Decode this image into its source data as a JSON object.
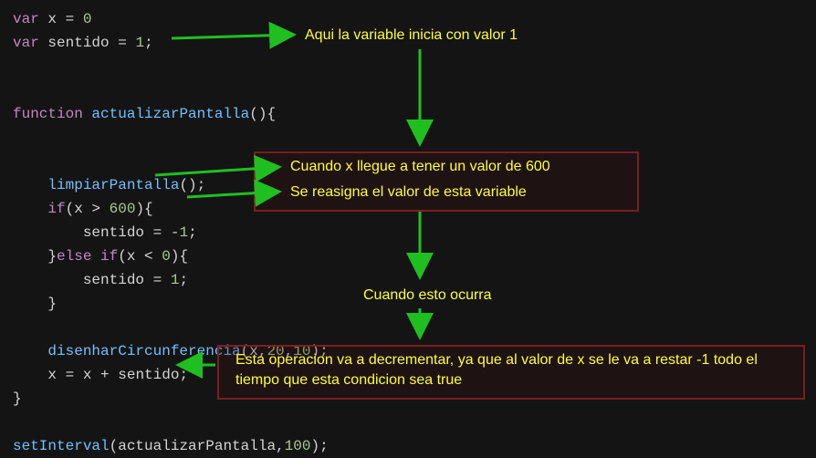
{
  "code": {
    "l1a": "var",
    "l1b": " x ",
    "l1c": "=",
    "l1d": " ",
    "l1e": "0",
    "l2a": "var",
    "l2b": " sentido ",
    "l2c": "=",
    "l2d": " ",
    "l2e": "1",
    "l2f": ";",
    "l4a": "function",
    "l4b": " ",
    "l4c": "actualizarPantalla",
    "l4d": "(){",
    "l7a": "    ",
    "l7b": "limpiarPantalla",
    "l7c": "();",
    "l8a": "    ",
    "l8b": "if",
    "l8c": "(x ",
    "l8d": ">",
    "l8e": " ",
    "l8f": "600",
    "l8g": "){",
    "l9a": "        sentido ",
    "l9b": "=",
    "l9c": " ",
    "l9d": "-",
    "l9e": "1",
    "l9f": ";",
    "l10a": "    }",
    "l10b": "else",
    "l10c": " ",
    "l10d": "if",
    "l10e": "(x ",
    "l10f": "<",
    "l10g": " ",
    "l10h": "0",
    "l10i": "){",
    "l11a": "        sentido ",
    "l11b": "=",
    "l11c": " ",
    "l11d": "1",
    "l11e": ";",
    "l12a": "    }",
    "l14a": "    ",
    "l14b": "disenharCircunferencia",
    "l14c": "(x,",
    "l14d": "20",
    "l14e": ",",
    "l14f": "10",
    "l14g": ");",
    "l15a": "    x ",
    "l15b": "=",
    "l15c": " x ",
    "l15d": "+",
    "l15e": " sentido;",
    "l16a": "}",
    "l18a": "setInterval",
    "l18b": "(actualizarPantalla,",
    "l18c": "100",
    "l18d": ");"
  },
  "annot": {
    "a1": "Aqui la variable inicia con valor 1",
    "a2": "Cuando x llegue a tener un valor de 600",
    "a3": "Se reasigna el valor de esta variable",
    "a4": "Cuando esto ocurra",
    "a5": "Esta operacion va a decrementar, ya que al valor de x se le va a restar -1 todo el tiempo que esta condicion sea true"
  }
}
